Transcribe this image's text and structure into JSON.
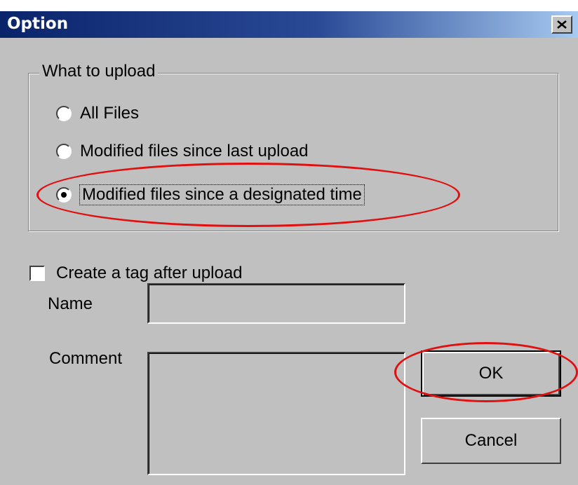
{
  "window": {
    "title": "Option",
    "close_icon": "close-icon"
  },
  "upload_group": {
    "legend": "What to upload",
    "options": [
      {
        "label": "All Files",
        "selected": false
      },
      {
        "label": "Modified files since last upload",
        "selected": false
      },
      {
        "label": "Modified files since a designated time",
        "selected": true
      }
    ]
  },
  "tag": {
    "checkbox_label": "Create a tag after upload",
    "checked": false
  },
  "fields": {
    "name_label": "Name",
    "name_value": "",
    "comment_label": "Comment",
    "comment_value": ""
  },
  "buttons": {
    "ok": "OK",
    "cancel": "Cancel"
  },
  "annotation_color": "#e01010"
}
